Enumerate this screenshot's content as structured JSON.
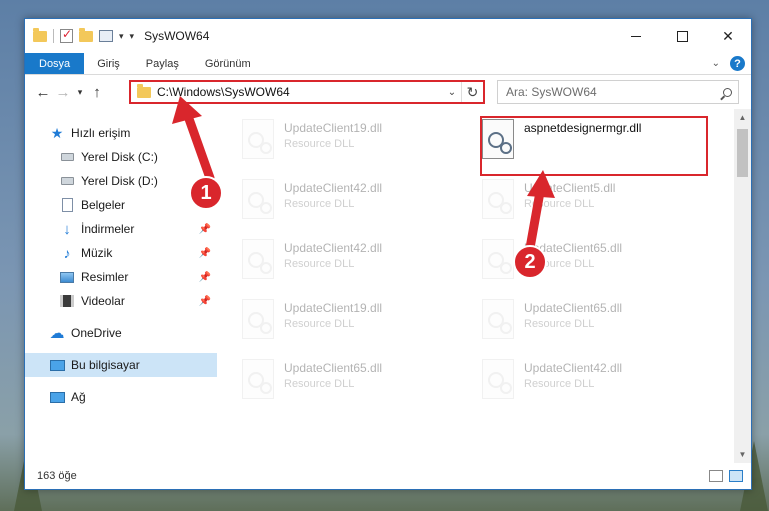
{
  "window": {
    "title": "SysWOW64"
  },
  "ribbon": {
    "tabs": [
      "Dosya",
      "Giriş",
      "Paylaş",
      "Görünüm"
    ]
  },
  "address": {
    "path": "C:\\Windows\\SysWOW64"
  },
  "search": {
    "placeholder": "Ara: SysWOW64"
  },
  "nav": {
    "quick_access": "Hızlı erişim",
    "items": [
      "Yerel Disk (C:)",
      "Yerel Disk (D:)",
      "Belgeler",
      "İndirmeler",
      "Müzik",
      "Resimler",
      "Videolar"
    ],
    "onedrive": "OneDrive",
    "this_pc": "Bu bilgisayar",
    "network": "Ağ"
  },
  "files": [
    {
      "name": "UpdateClient19.dll",
      "type": "Resource DLL"
    },
    {
      "name": "aspnetdesignermgr.dll",
      "type": ""
    },
    {
      "name": "UpdateClient42.dll",
      "type": "Resource DLL"
    },
    {
      "name": "UpdateClient5.dll",
      "type": "Resource DLL"
    },
    {
      "name": "UpdateClient42.dll",
      "type": "Resource DLL"
    },
    {
      "name": "UpdateClient65.dll",
      "type": "Resource DLL"
    },
    {
      "name": "UpdateClient19.dll",
      "type": "Resource DLL"
    },
    {
      "name": "UpdateClient65.dll",
      "type": "Resource DLL"
    },
    {
      "name": "UpdateClient65.dll",
      "type": "Resource DLL"
    },
    {
      "name": "UpdateClient42.dll",
      "type": "Resource DLL"
    }
  ],
  "status": {
    "count": "163 öğe"
  },
  "annotations": {
    "badge1": "1",
    "badge2": "2",
    "color": "#d9262c"
  },
  "icons": {
    "title": [
      "folder-icon",
      "properties-icon",
      "new-folder-icon"
    ],
    "nav": [
      "star-icon",
      "drive-icon",
      "drive-icon",
      "documents-icon",
      "downloads-icon",
      "music-icon",
      "pictures-icon",
      "videos-icon",
      "onedrive-icon",
      "computer-icon",
      "network-icon"
    ]
  }
}
